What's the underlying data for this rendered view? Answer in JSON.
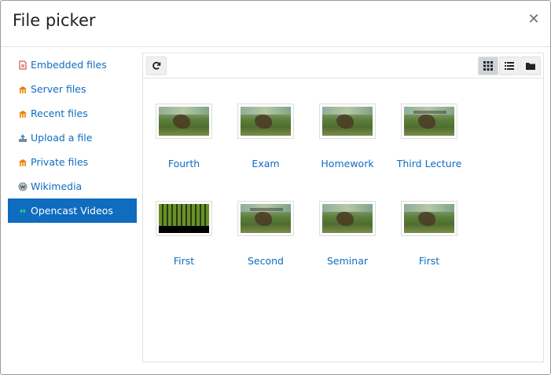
{
  "dialog": {
    "title": "File picker",
    "close_icon": "close-icon"
  },
  "sidebar": {
    "items": [
      {
        "label": "Embedded files",
        "icon": "document-icon",
        "active": false
      },
      {
        "label": "Server files",
        "icon": "moodle-icon",
        "active": false
      },
      {
        "label": "Recent files",
        "icon": "moodle-icon",
        "active": false
      },
      {
        "label": "Upload a file",
        "icon": "upload-icon",
        "active": false
      },
      {
        "label": "Private files",
        "icon": "moodle-icon",
        "active": false
      },
      {
        "label": "Wikimedia",
        "icon": "wikimedia-icon",
        "active": false
      },
      {
        "label": "Opencast Videos",
        "icon": "opencast-icon",
        "active": true
      }
    ]
  },
  "toolbar": {
    "refresh_icon": "refresh-icon",
    "views": [
      "grid-view-icon",
      "list-view-icon",
      "folder-view-icon"
    ],
    "active_view": "grid"
  },
  "files": [
    {
      "label": "Fourth",
      "thumb": "landscape"
    },
    {
      "label": "Exam",
      "thumb": "landscape"
    },
    {
      "label": "Homework",
      "thumb": "landscape"
    },
    {
      "label": "Third Lecture",
      "thumb": "text"
    },
    {
      "label": "First",
      "thumb": "dark"
    },
    {
      "label": "Second",
      "thumb": "text"
    },
    {
      "label": "Seminar",
      "thumb": "landscape"
    },
    {
      "label": "First",
      "thumb": "landscape"
    }
  ],
  "colors": {
    "accent": "#0f6cbf",
    "border": "#dee2e6"
  }
}
